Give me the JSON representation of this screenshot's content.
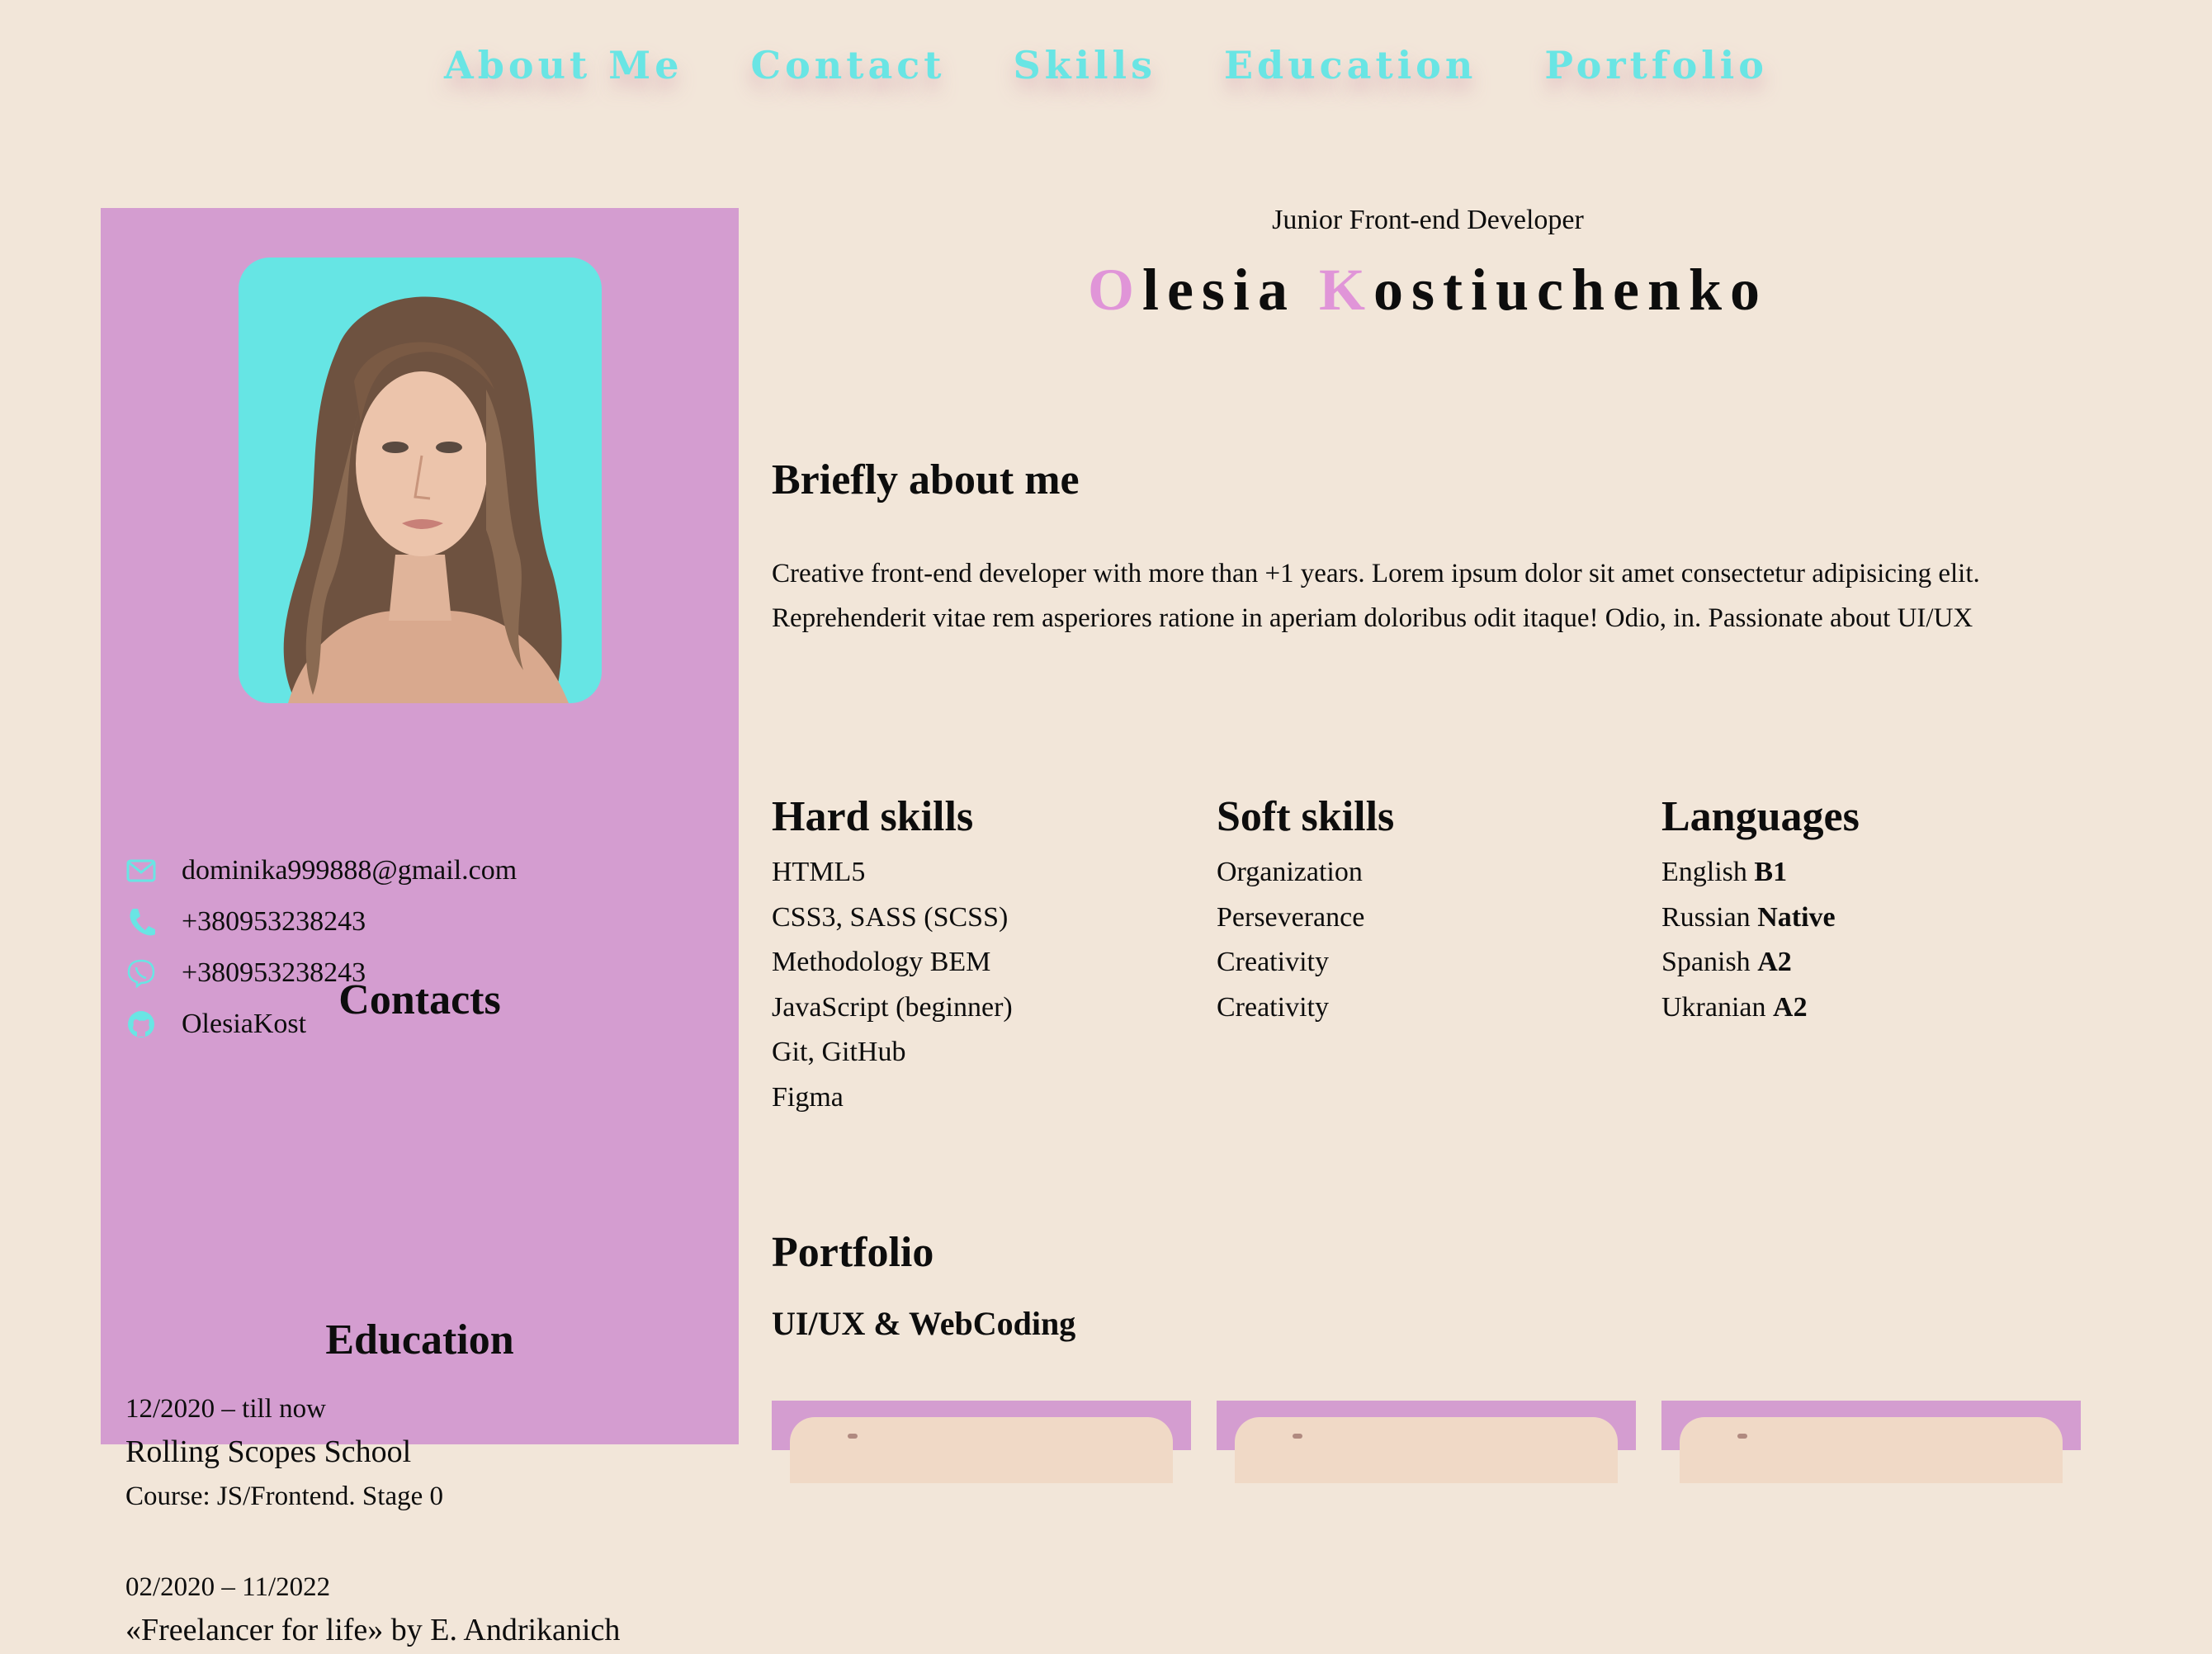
{
  "nav": {
    "items": [
      {
        "label": "About Me"
      },
      {
        "label": "Contact"
      },
      {
        "label": "Skills"
      },
      {
        "label": "Education"
      },
      {
        "label": "Portfolio"
      }
    ]
  },
  "header": {
    "subtitle": "Junior Front-end Developer",
    "first_initial": "O",
    "first_rest": "lesia",
    "last_initial": "K",
    "last_rest": "ostiuchenko"
  },
  "sidebar": {
    "contacts_heading": "Contacts",
    "contacts": [
      {
        "icon": "mail-icon",
        "text": "dominika999888@gmail.com"
      },
      {
        "icon": "phone-icon",
        "text": "+380953238243"
      },
      {
        "icon": "viber-icon",
        "text": "+380953238243"
      },
      {
        "icon": "github-icon",
        "text": "OlesiaKost"
      }
    ],
    "education_heading": "Education",
    "education": [
      {
        "date": "12/2020 – till now",
        "school": "Rolling Scopes School",
        "course": "Course: JS/Frontend. Stage 0"
      },
      {
        "date": "02/2020 – 11/2022",
        "school": "«Freelancer for life» by E. Andrikanich"
      }
    ]
  },
  "about": {
    "heading": "Briefly about me",
    "text": "Creative front-end developer with more than +1 years. Lorem ipsum dolor sit amet consectetur adipisicing elit. Reprehenderit vitae rem asperiores ratione in aperiam doloribus odit itaque! Odio, in. Passionate about UI/UX"
  },
  "skills": {
    "hard_heading": "Hard skills",
    "hard": [
      "HTML5",
      "CSS3, SASS (SCSS)",
      "Methodology BEM",
      "JavaScript (beginner)",
      "Git, GitHub",
      "Figma"
    ],
    "soft_heading": "Soft skills",
    "soft": [
      "Organization",
      "Perseverance",
      "Creativity",
      "Creativity"
    ],
    "lang_heading": "Languages",
    "languages": [
      {
        "name": "English",
        "level": "B1"
      },
      {
        "name": "Russian",
        "level": "Native"
      },
      {
        "name": "Spanish",
        "level": "A2"
      },
      {
        "name": "Ukranian",
        "level": "A2"
      }
    ]
  },
  "portfolio": {
    "heading": "Portfolio",
    "subheading": "UI/UX & WebCoding"
  },
  "colors": {
    "background": "#f2e6d9",
    "sidebar": "#d49dd0",
    "accent_cyan": "#69e5e4",
    "accent_pink": "#e095d8"
  }
}
